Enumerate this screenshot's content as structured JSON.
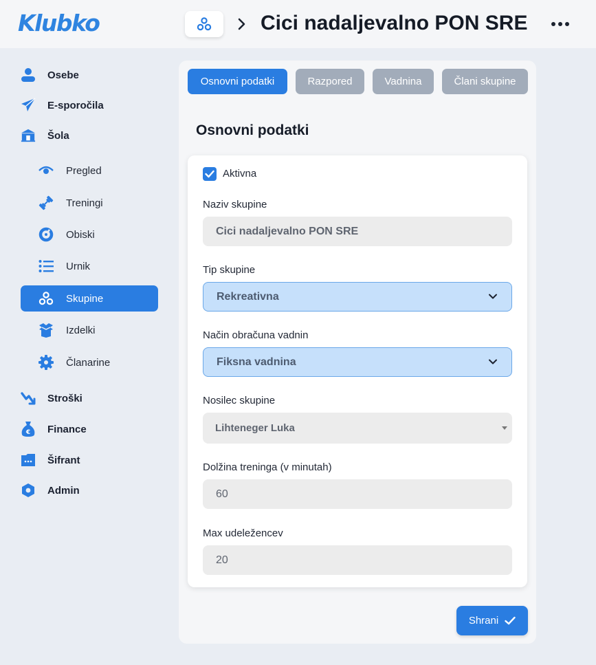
{
  "header": {
    "logo": "Klubko",
    "group_icon": "group-icon",
    "title": "Cici nadaljevalno PON SRE",
    "more_icon": "more-icon"
  },
  "sidebar": {
    "items": [
      {
        "label": "Osebe",
        "icon": "user-icon"
      },
      {
        "label": "E-sporočila",
        "icon": "paper-plane-icon"
      },
      {
        "label": "Šola",
        "icon": "school-icon"
      },
      {
        "label": "Stroški",
        "icon": "trend-icon"
      },
      {
        "label": "Finance",
        "icon": "money-bag-icon"
      },
      {
        "label": "Šifrant",
        "icon": "code-folder-icon"
      },
      {
        "label": "Admin",
        "icon": "hexagon-icon"
      }
    ],
    "sub_items": [
      {
        "label": "Pregled",
        "icon": "eye-icon"
      },
      {
        "label": "Treningi",
        "icon": "dumbbell-icon"
      },
      {
        "label": "Obiski",
        "icon": "gauge-icon"
      },
      {
        "label": "Urnik",
        "icon": "list-icon"
      },
      {
        "label": "Skupine",
        "icon": "group-icon",
        "active": true
      },
      {
        "label": "Izdelki",
        "icon": "box-icon"
      },
      {
        "label": "Članarine",
        "icon": "gear-icon"
      }
    ]
  },
  "tabs": [
    {
      "label": "Osnovni podatki",
      "active": true
    },
    {
      "label": "Razpored",
      "active": false
    },
    {
      "label": "Vadnina",
      "active": false
    },
    {
      "label": "Člani skupine",
      "active": false
    }
  ],
  "section_title": "Osnovni podatki",
  "form": {
    "active_label": "Aktivna",
    "active_checked": true,
    "name_label": "Naziv skupine",
    "name_value": "Cici nadaljevalno PON SRE",
    "type_label": "Tip skupine",
    "type_value": "Rekreativna",
    "billing_label": "Način obračuna vadnin",
    "billing_value": "Fiksna vadnina",
    "holder_label": "Nosilec skupine",
    "holder_value": "Lihteneger Luka",
    "duration_label": "Dolžina treninga (v minutah)",
    "duration_value": "60",
    "max_label": "Max udeležencev",
    "max_value": "20"
  },
  "save_label": "Shrani",
  "colors": {
    "accent": "#2a7de1",
    "tab_inactive": "#a2acba",
    "select_bg": "#c6e0fb"
  }
}
